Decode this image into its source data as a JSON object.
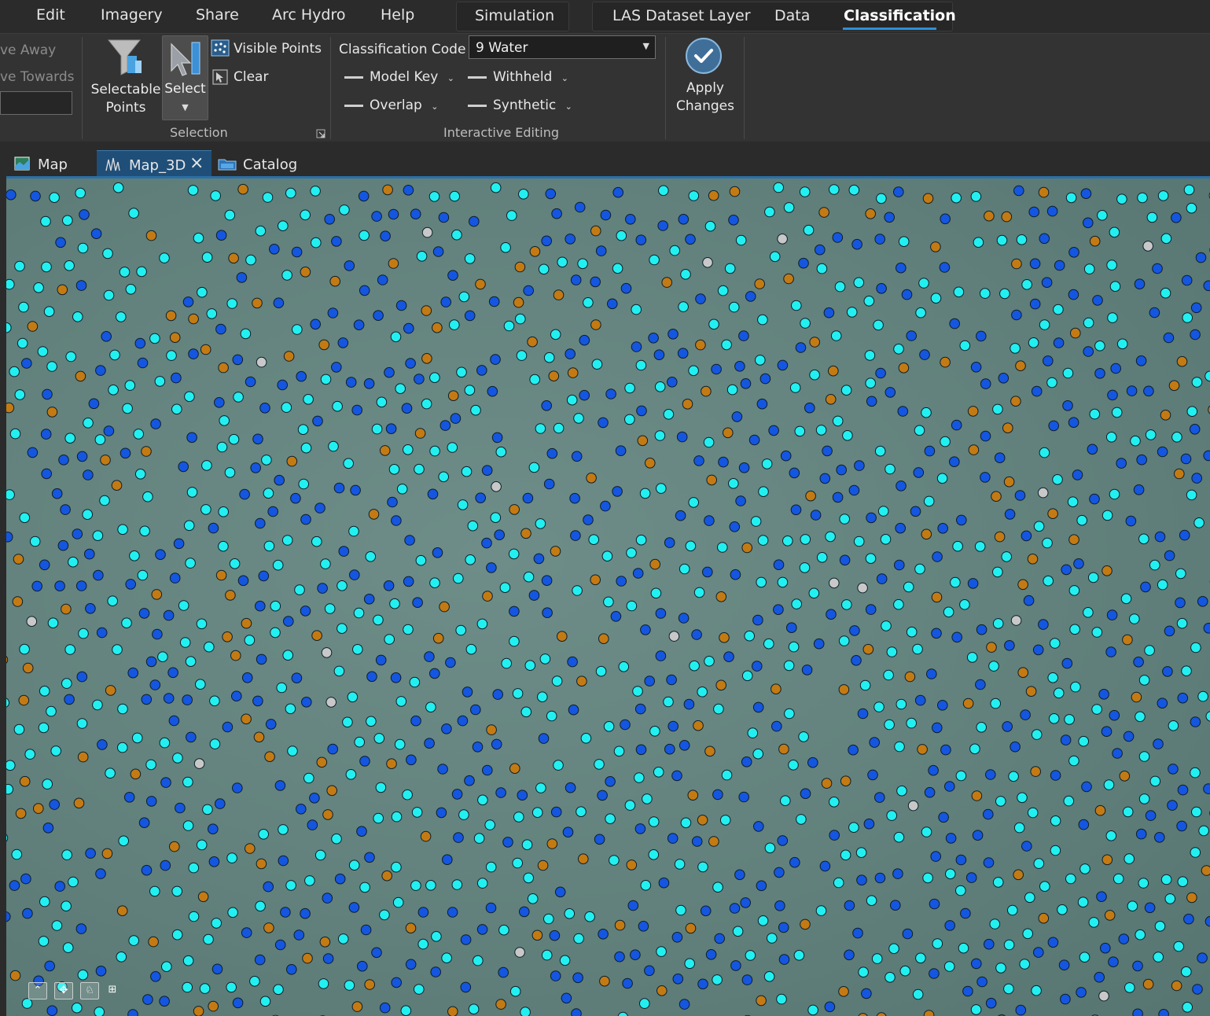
{
  "menu": {
    "items": [
      "Edit",
      "Imagery",
      "Share",
      "Arc Hydro",
      "Help"
    ],
    "simulation": "Simulation",
    "context_tabs": [
      "LAS Dataset Layer",
      "Data",
      "Classification"
    ],
    "active_context_tab": "Classification"
  },
  "ribbon": {
    "partial_move_away": "ve Away",
    "partial_move_towards": "ve Towards",
    "selectable_points_line1": "Selectable",
    "selectable_points_line2": "Points",
    "select_label": "Select",
    "visible_points": "Visible Points",
    "clear": "Clear",
    "selection_group": "Selection",
    "classification_code_label": "Classification Code",
    "classification_code_value": "9 Water",
    "model_key": "Model Key",
    "withheld": "Withheld",
    "overlap": "Overlap",
    "synthetic": "Synthetic",
    "interactive_editing_group": "Interactive Editing",
    "apply_line1": "Apply",
    "apply_line2": "Changes"
  },
  "tabs": [
    {
      "label": "Map",
      "icon": "map-icon"
    },
    {
      "label": "Map_3D",
      "icon": "map-3d-icon",
      "active": true,
      "closable": true
    },
    {
      "label": "Catalog",
      "icon": "catalog-icon"
    }
  ],
  "map": {
    "point_classes": [
      {
        "name": "cyan",
        "color": "#22f0f0"
      },
      {
        "name": "blue",
        "color": "#1556e0"
      },
      {
        "name": "orange",
        "color": "#c47a12"
      },
      {
        "name": "gray",
        "color": "#c8c8c8"
      }
    ],
    "nav_controls": [
      "navigate-up-icon",
      "full-extent-icon",
      "walk-icon",
      "grid-icon"
    ]
  },
  "colors": {
    "accent": "#2f8fd8",
    "ribbon_bg": "#333333",
    "menu_bg": "#2b2b2b",
    "active_tab_bg": "#1f4f78"
  }
}
